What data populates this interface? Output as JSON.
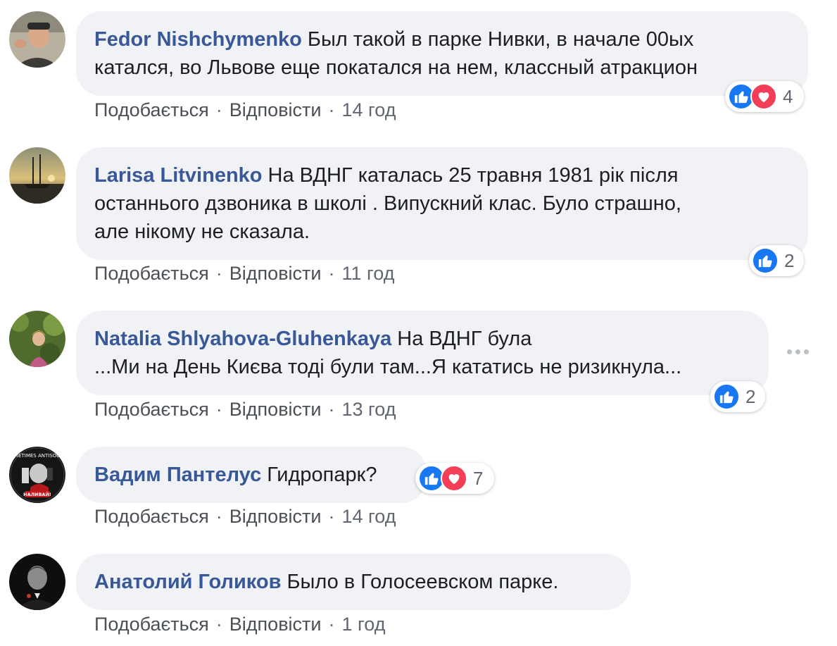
{
  "comments": [
    {
      "author": "Fedor Nishchymenko",
      "text": "Был такой в парке Нивки, в начале 00ых\nкатался, во Львове еще покатался на нем, классный атракцион",
      "like": "Подобається",
      "reply": "Відповісти",
      "time": "14 год",
      "reactions": [
        "like",
        "love"
      ],
      "reaction_count": "4"
    },
    {
      "author": "Larisa Litvinenko",
      "text": "На ВДНГ каталась 25 травня 1981 рік після\nостаннього дзвоника в школі . Випускний клас. Було страшно,\nале нікому не сказала.",
      "like": "Подобається",
      "reply": "Відповісти",
      "time": "11 год",
      "reactions": [
        "like"
      ],
      "reaction_count": "2"
    },
    {
      "author": "Natalia Shlyahova-Gluhenkaya",
      "text": "На ВДНГ була\n...Ми на День Києва тоді були там...Я кататись не ризикнула...",
      "like": "Подобається",
      "reply": "Відповісти",
      "time": "13 год",
      "reactions": [
        "like"
      ],
      "reaction_count": "2"
    },
    {
      "author": "Вадим Пантелус",
      "text": "Гидропарк?",
      "like": "Подобається",
      "reply": "Відповісти",
      "time": "14 год",
      "reactions": [
        "like",
        "love"
      ],
      "reaction_count": "7"
    },
    {
      "author": "Анатолий Голиков",
      "text": "Было в Голосеевском парке.",
      "like": "Подобається",
      "reply": "Відповісти",
      "time": "1 год",
      "reactions": [],
      "reaction_count": ""
    }
  ],
  "avatar_logo": {
    "top_text": "SOMETIMES ANTISOCIAL",
    "bottom_text": "НАЛИВАЙ!"
  },
  "colors": {
    "author": "#385898",
    "bubble": "#f0f2f5",
    "like": "#1877f2",
    "love": "#f33e58"
  },
  "icons": {
    "like": "thumbs-up-icon",
    "love": "heart-icon",
    "more": "more-options-icon"
  }
}
